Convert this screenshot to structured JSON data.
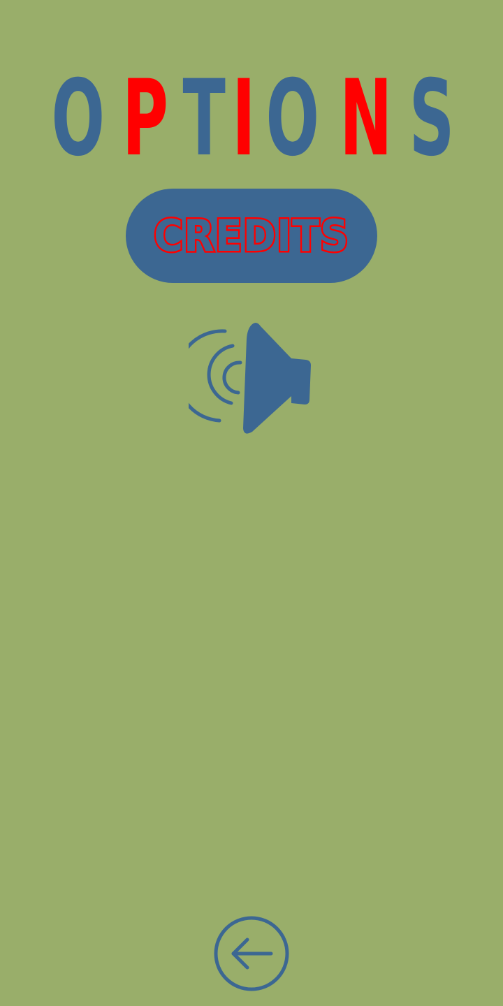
{
  "title": {
    "letters": [
      "O",
      "P",
      "T",
      "I",
      "O",
      "N",
      "S"
    ],
    "letter_colors": [
      "#3c6792",
      "#ff0000",
      "#3c6792",
      "#ff0000",
      "#3c6792",
      "#ff0000",
      "#3c6792"
    ]
  },
  "credits_button": {
    "label": "CREDITS",
    "background": "#3c6792",
    "text_color": "#3c6792",
    "outline_color": "#ff0000"
  },
  "sound_toggle": {
    "icon": "speaker-icon",
    "state": "on",
    "color": "#3c6792"
  },
  "back_button": {
    "icon": "back-arrow-icon",
    "color": "#3c6792"
  },
  "colors": {
    "background": "#99ae6a",
    "primary": "#3c6792",
    "accent": "#ff0000"
  }
}
